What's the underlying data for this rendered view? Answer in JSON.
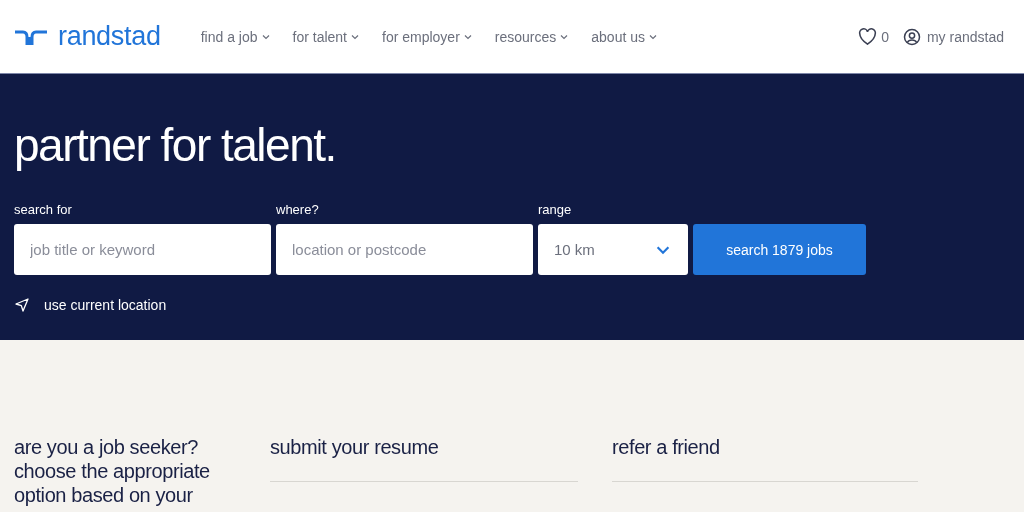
{
  "header": {
    "logo": "randstad",
    "nav": [
      {
        "label": "find a job"
      },
      {
        "label": "for talent"
      },
      {
        "label": "for employer"
      },
      {
        "label": "resources"
      },
      {
        "label": "about us"
      }
    ],
    "favorites_count": "0",
    "account": "my randstad"
  },
  "hero": {
    "title": "partner for talent.",
    "fields": [
      {
        "kind": "input",
        "label": "search for",
        "placeholder": "job title or keyword"
      },
      {
        "kind": "input",
        "label": "where?",
        "placeholder": "location or postcode"
      },
      {
        "kind": "select",
        "label": "range",
        "value": "10 km"
      }
    ],
    "search_button": "search 1879 jobs",
    "location_link": "use current location"
  },
  "sections": [
    {
      "title": "are you a job seeker? choose the appropriate option based on your"
    },
    {
      "title": "submit your resume",
      "underline": true
    },
    {
      "title": "refer a friend",
      "underline": true
    }
  ]
}
